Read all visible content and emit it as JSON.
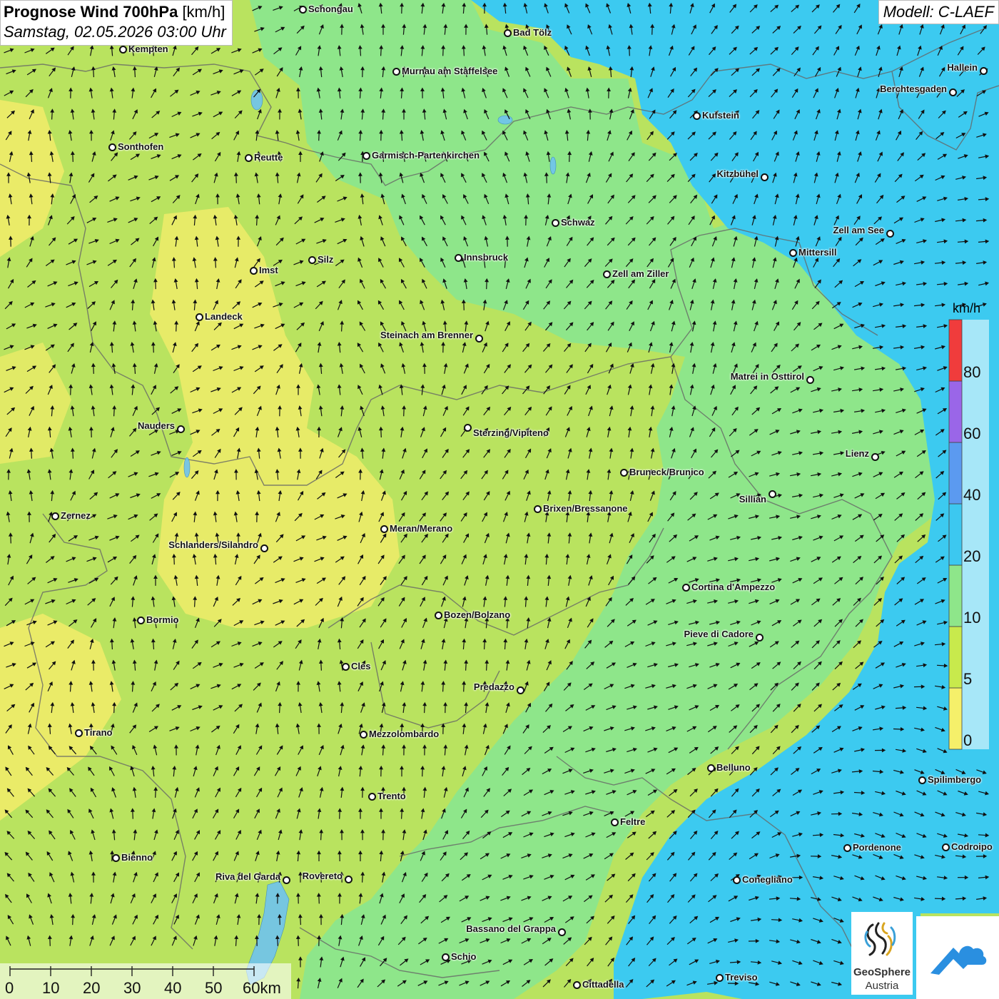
{
  "title": {
    "main_bold": "Prognose Wind 700hPa",
    "main_unit": "[km/h]",
    "subtitle": "Samstag, 02.05.2026 03:00 Uhr"
  },
  "model_label": "Modell: C-LAEF",
  "legend": {
    "unit": "km/h",
    "labels": [
      "0",
      "5",
      "10",
      "20",
      "40",
      "60",
      "80"
    ],
    "colors": {
      "band_0_5": "#f5f06a",
      "band_5_10": "#c8ea4c",
      "band_10_20": "#8ee68a",
      "band_20_40": "#3cc8f0",
      "band_40_60": "#5b9af0",
      "band_60_80": "#9a66e8",
      "band_80_plus": "#f03c3c"
    }
  },
  "scale_bar": {
    "labels": [
      "0",
      "10",
      "20",
      "30",
      "40",
      "50",
      "60km"
    ]
  },
  "logo": {
    "name_line1": "GeoSphere",
    "name_line2": "Austria"
  },
  "cities": [
    {
      "name": "Schongau"
    },
    {
      "name": "Bad Tölz"
    },
    {
      "name": "Kempten"
    },
    {
      "name": "Murnau am Staffelsee"
    },
    {
      "name": "Hallein"
    },
    {
      "name": "Berchtesgaden"
    },
    {
      "name": "Kufstein"
    },
    {
      "name": "Sonthofen"
    },
    {
      "name": "Reutte"
    },
    {
      "name": "Garmisch-Partenkirchen"
    },
    {
      "name": "Kitzbühel"
    },
    {
      "name": "Schwaz"
    },
    {
      "name": "Zell am See"
    },
    {
      "name": "Mittersill"
    },
    {
      "name": "Innsbruck"
    },
    {
      "name": "Silz"
    },
    {
      "name": "Imst"
    },
    {
      "name": "Zell am Ziller"
    },
    {
      "name": "Landeck"
    },
    {
      "name": "Steinach am Brenner"
    },
    {
      "name": "Matrei in Osttirol"
    },
    {
      "name": "Nauders"
    },
    {
      "name": "Sterzing/Vipiteno"
    },
    {
      "name": "Lienz"
    },
    {
      "name": "Bruneck/Brunico"
    },
    {
      "name": "Sillian"
    },
    {
      "name": "Zernez"
    },
    {
      "name": "Brixen/Bressanone"
    },
    {
      "name": "Meran/Merano"
    },
    {
      "name": "Schlanders/Silandro"
    },
    {
      "name": "Cortina d'Ampezzo"
    },
    {
      "name": "Bozen/Bolzano"
    },
    {
      "name": "Bormio"
    },
    {
      "name": "Pieve di Cadore"
    },
    {
      "name": "Cles"
    },
    {
      "name": "Predazzo"
    },
    {
      "name": "Tirano"
    },
    {
      "name": "Mezzolombardo"
    },
    {
      "name": "Belluno"
    },
    {
      "name": "Spilimbergo"
    },
    {
      "name": "Trento"
    },
    {
      "name": "Feltre"
    },
    {
      "name": "Bienno"
    },
    {
      "name": "Pordenone"
    },
    {
      "name": "Codroipo"
    },
    {
      "name": "Riva del Garda"
    },
    {
      "name": "Rovereto"
    },
    {
      "name": "Conegliano"
    },
    {
      "name": "Bassano del Grappa"
    },
    {
      "name": "Schio"
    },
    {
      "name": "Treviso"
    },
    {
      "name": "Cittadella"
    }
  ]
}
